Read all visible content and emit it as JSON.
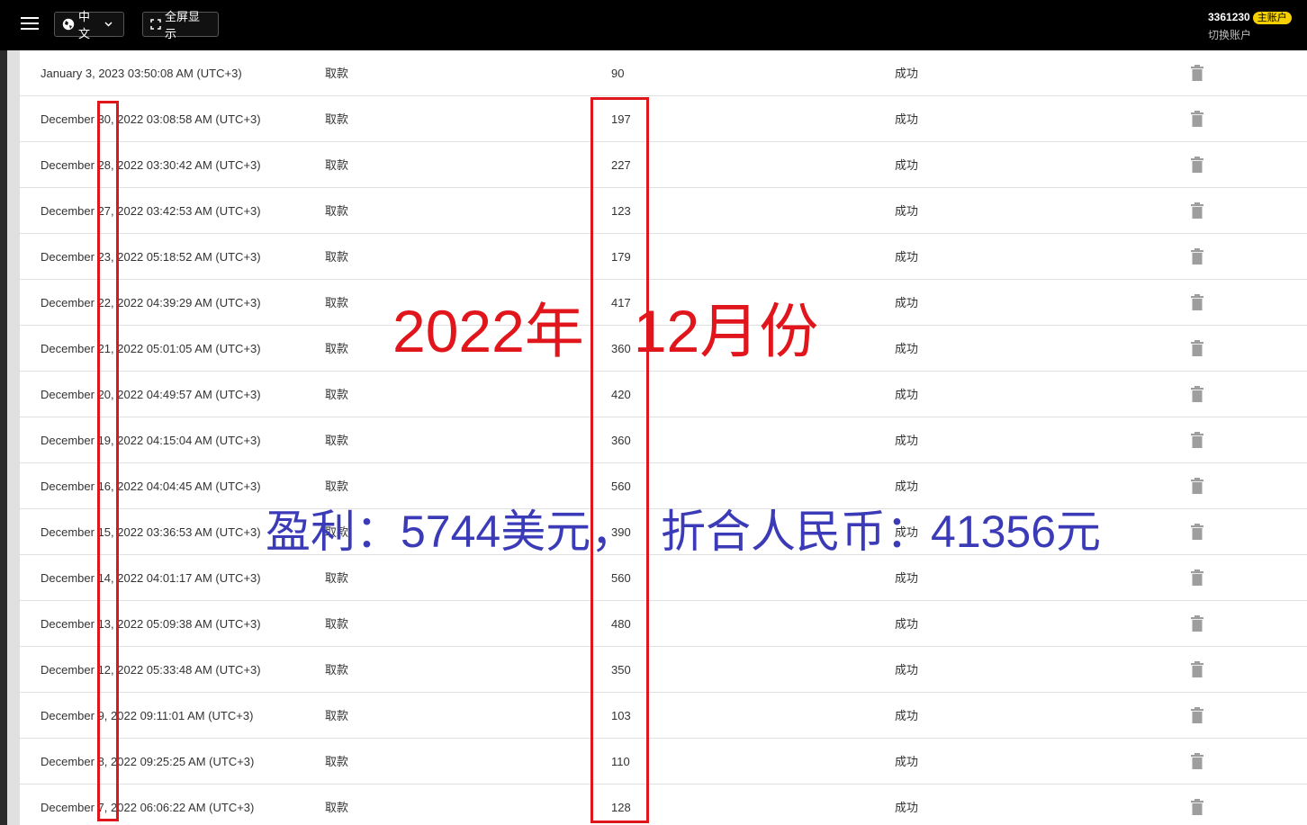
{
  "topbar": {
    "language_label": "中文",
    "fullscreen_label": "全屏显示",
    "account_id": "3361230",
    "account_badge": "主账户",
    "switch_account": "切换账户"
  },
  "transactions": [
    {
      "date": "January 3, 2023 03:50:08 AM (UTC+3)",
      "type": "取款",
      "amount": "90",
      "status": "成功"
    },
    {
      "date": "December 30, 2022 03:08:58 AM (UTC+3)",
      "type": "取款",
      "amount": "197",
      "status": "成功"
    },
    {
      "date": "December 28, 2022 03:30:42 AM (UTC+3)",
      "type": "取款",
      "amount": "227",
      "status": "成功"
    },
    {
      "date": "December 27, 2022 03:42:53 AM (UTC+3)",
      "type": "取款",
      "amount": "123",
      "status": "成功"
    },
    {
      "date": "December 23, 2022 05:18:52 AM (UTC+3)",
      "type": "取款",
      "amount": "179",
      "status": "成功"
    },
    {
      "date": "December 22, 2022 04:39:29 AM (UTC+3)",
      "type": "取款",
      "amount": "417",
      "status": "成功"
    },
    {
      "date": "December 21, 2022 05:01:05 AM (UTC+3)",
      "type": "取款",
      "amount": "360",
      "status": "成功"
    },
    {
      "date": "December 20, 2022 04:49:57 AM (UTC+3)",
      "type": "取款",
      "amount": "420",
      "status": "成功"
    },
    {
      "date": "December 19, 2022 04:15:04 AM (UTC+3)",
      "type": "取款",
      "amount": "360",
      "status": "成功"
    },
    {
      "date": "December 16, 2022 04:04:45 AM (UTC+3)",
      "type": "取款",
      "amount": "560",
      "status": "成功"
    },
    {
      "date": "December 15, 2022 03:36:53 AM (UTC+3)",
      "type": "取款",
      "amount": "390",
      "status": "成功"
    },
    {
      "date": "December 14, 2022 04:01:17 AM (UTC+3)",
      "type": "取款",
      "amount": "560",
      "status": "成功"
    },
    {
      "date": "December 13, 2022 05:09:38 AM (UTC+3)",
      "type": "取款",
      "amount": "480",
      "status": "成功"
    },
    {
      "date": "December 12, 2022 05:33:48 AM (UTC+3)",
      "type": "取款",
      "amount": "350",
      "status": "成功"
    },
    {
      "date": "December 9, 2022 09:11:01 AM (UTC+3)",
      "type": "取款",
      "amount": "103",
      "status": "成功"
    },
    {
      "date": "December 8, 2022 09:25:25 AM (UTC+3)",
      "type": "取款",
      "amount": "110",
      "status": "成功"
    },
    {
      "date": "December 7, 2022 06:06:22 AM (UTC+3)",
      "type": "取款",
      "amount": "128",
      "status": "成功"
    }
  ],
  "annotations": {
    "month_label": "2022年   12月份",
    "profit_label": "盈利：5744美元，  折合人民币：41356元",
    "accent_red": "#e0161c",
    "accent_blue": "#3b3bb8"
  }
}
